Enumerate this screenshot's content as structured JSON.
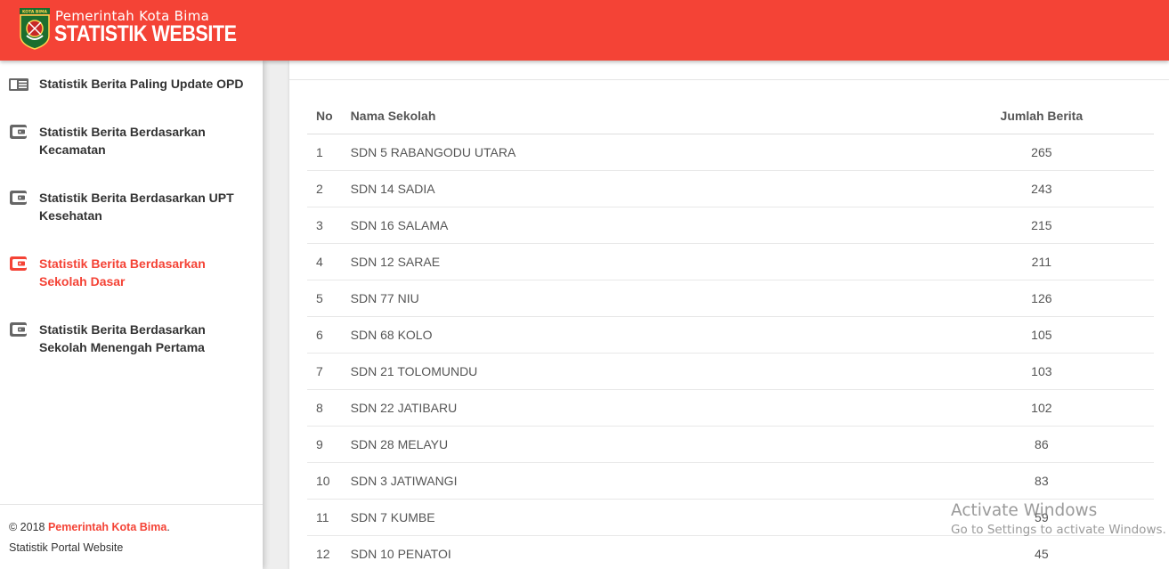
{
  "header": {
    "subtitle": "Pemerintah Kota Bima",
    "title": "STATISTIK WEBSITE",
    "logo_text": "KOTA BIMA"
  },
  "sidebar": {
    "items": [
      {
        "label": "Statistik Berita Paling Update OPD",
        "icon": "newspaper-icon",
        "active": false
      },
      {
        "label": "Statistik Berita Berdasarkan Kecamatan",
        "icon": "wallet-icon",
        "active": false
      },
      {
        "label": "Statistik Berita Berdasarkan UPT Kesehatan",
        "icon": "wallet-icon",
        "active": false
      },
      {
        "label": "Statistik Berita Berdasarkan Sekolah Dasar",
        "icon": "wallet-icon",
        "active": true
      },
      {
        "label": "Statistik Berita Berdasarkan Sekolah Menengah Pertama",
        "icon": "wallet-icon",
        "active": false
      }
    ],
    "footer": {
      "copyright": "© 2018 ",
      "brand": "Pemerintah Kota Bima",
      "period": ".",
      "tagline": "Statistik Portal Website"
    }
  },
  "table": {
    "headers": {
      "no": "No",
      "name": "Nama Sekolah",
      "count": "Jumlah Berita"
    },
    "rows": [
      {
        "no": "1",
        "name": "SDN 5 RABANGODU UTARA",
        "count": "265"
      },
      {
        "no": "2",
        "name": "SDN 14 SADIA",
        "count": "243"
      },
      {
        "no": "3",
        "name": "SDN 16 SALAMA",
        "count": "215"
      },
      {
        "no": "4",
        "name": "SDN 12 SARAE",
        "count": "211"
      },
      {
        "no": "5",
        "name": "SDN 77 NIU",
        "count": "126"
      },
      {
        "no": "6",
        "name": "SDN 68 KOLO",
        "count": "105"
      },
      {
        "no": "7",
        "name": "SDN 21 TOLOMUNDU",
        "count": "103"
      },
      {
        "no": "8",
        "name": "SDN 22 JATIBARU",
        "count": "102"
      },
      {
        "no": "9",
        "name": "SDN 28 MELAYU",
        "count": "86"
      },
      {
        "no": "10",
        "name": "SDN 3 JATIWANGI",
        "count": "83"
      },
      {
        "no": "11",
        "name": "SDN 7 KUMBE",
        "count": "59"
      },
      {
        "no": "12",
        "name": "SDN 10 PENATOI",
        "count": "45"
      }
    ]
  },
  "watermark": {
    "title": "Activate Windows",
    "subtitle": "Go to Settings to activate Windows."
  },
  "colors": {
    "brand": "#f44336",
    "text": "#333333"
  }
}
